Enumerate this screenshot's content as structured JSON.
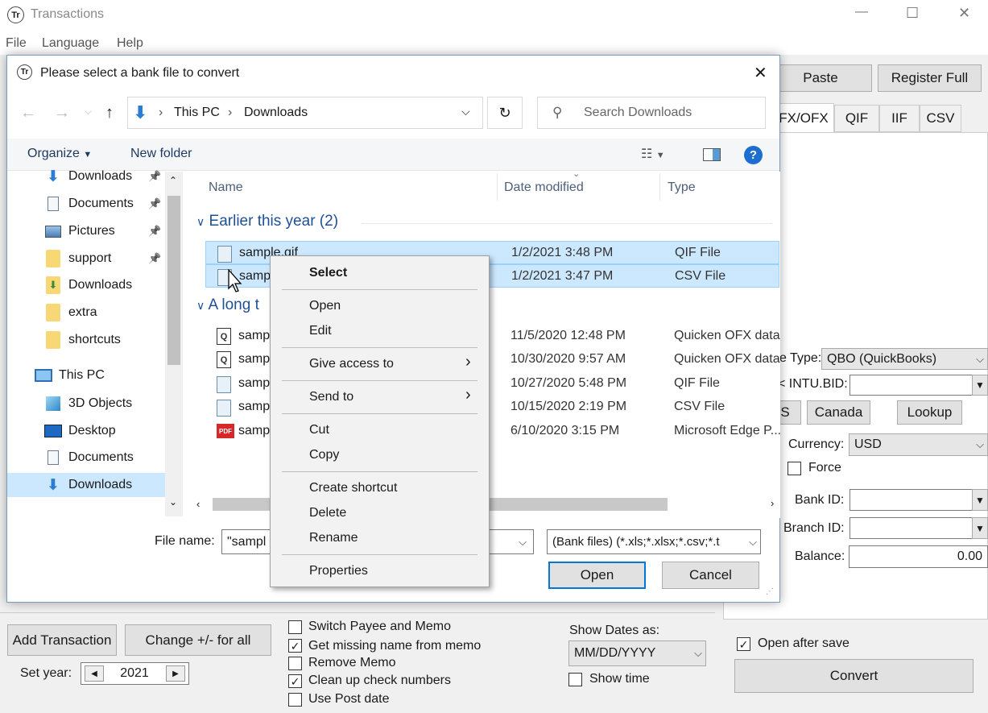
{
  "app": {
    "title": "Transactions",
    "icon_text": "Tr",
    "menu": [
      "File",
      "Language",
      "Help"
    ],
    "window_controls": {
      "minimize": "—",
      "maximize": "☐",
      "close": "✕"
    }
  },
  "right_panel": {
    "paste_label": "Paste",
    "register_label": "Register Full",
    "tabs": [
      "FX/OFX",
      "QIF",
      "IIF",
      "CSV"
    ],
    "type_label": "e Type:",
    "type_value": "QBO (QuickBooks)",
    "intubid_label": "< INTU.BID:",
    "intubid_value": "",
    "s_label": "S",
    "canada_label": "Canada",
    "lookup_label": "Lookup",
    "currency_label": "Currency:",
    "currency_value": "USD",
    "force_label": "Force",
    "bankid_label": "Bank ID:",
    "branchid_label": "Branch ID:",
    "balance_label": "Balance:",
    "balance_value": "0.00",
    "open_after_save_label": "Open after save",
    "convert_label": "Convert"
  },
  "bottom": {
    "add_transaction": "Add Transaction",
    "change_sign": "Change +/- for all",
    "set_year_label": "Set year:",
    "year_value": "2021",
    "options": [
      {
        "label": "Switch Payee and Memo",
        "checked": false
      },
      {
        "label": "Get missing name from memo",
        "checked": true
      },
      {
        "label": "Remove Memo",
        "checked": false
      },
      {
        "label": "Clean up check numbers",
        "checked": true
      },
      {
        "label": "Use Post date",
        "checked": false
      }
    ],
    "show_dates_label": "Show Dates as:",
    "date_format": "MM/DD/YYYY",
    "show_time_label": "Show time"
  },
  "dialog": {
    "title": "Please select a bank file to convert",
    "breadcrumb": [
      "This PC",
      "Downloads"
    ],
    "search_placeholder": "Search Downloads",
    "organize_label": "Organize",
    "new_folder_label": "New folder",
    "nav_items": [
      {
        "label": "Downloads",
        "icon": "download-arrow-icon",
        "pinned": true
      },
      {
        "label": "Documents",
        "icon": "document-icon",
        "pinned": true
      },
      {
        "label": "Pictures",
        "icon": "pictures-icon",
        "pinned": true
      },
      {
        "label": "support",
        "icon": "folder-icon",
        "pinned": true
      },
      {
        "label": "Downloads",
        "icon": "folder-download-icon",
        "pinned": false
      },
      {
        "label": "extra",
        "icon": "folder-icon",
        "pinned": false
      },
      {
        "label": "shortcuts",
        "icon": "folder-icon",
        "pinned": false
      },
      {
        "label": "This PC",
        "icon": "computer-icon",
        "pinned": false
      },
      {
        "label": "3D Objects",
        "icon": "cube-icon",
        "pinned": false
      },
      {
        "label": "Desktop",
        "icon": "desktop-icon",
        "pinned": false
      },
      {
        "label": "Documents",
        "icon": "document-icon",
        "pinned": false
      },
      {
        "label": "Downloads",
        "icon": "download-arrow-icon",
        "pinned": false
      }
    ],
    "columns": [
      "Name",
      "Date modified",
      "Type"
    ],
    "group1": "Earlier this year (2)",
    "group2": "A long t",
    "files_group1": [
      {
        "name": "sample.qif",
        "date": "1/2/2021 3:48 PM",
        "type": "QIF File"
      },
      {
        "name": "sampl",
        "date": "1/2/2021 3:47 PM",
        "type": "CSV File"
      }
    ],
    "files_group2": [
      {
        "name": "sampl",
        "date": "11/5/2020 12:48 PM",
        "type": "Quicken OFX data"
      },
      {
        "name": "sampl",
        "date": "10/30/2020 9:57 AM",
        "type": "Quicken OFX data"
      },
      {
        "name": "sampl",
        "date": "10/27/2020 5:48 PM",
        "type": "QIF File"
      },
      {
        "name": "sampl",
        "date": "10/15/2020 2:19 PM",
        "type": "CSV File"
      },
      {
        "name": "sampl",
        "date": "6/10/2020 3:15 PM",
        "type": "Microsoft Edge P..."
      }
    ],
    "filename_label": "File name:",
    "filename_value": "\"sampl",
    "filter_value": "(Bank files) (*.xls;*.xlsx;*.csv;*.t",
    "open_label": "Open",
    "cancel_label": "Cancel"
  },
  "context_menu": {
    "select": "Select",
    "open": "Open",
    "edit": "Edit",
    "give_access": "Give access to",
    "send_to": "Send to",
    "cut": "Cut",
    "copy": "Copy",
    "create_shortcut": "Create shortcut",
    "delete": "Delete",
    "rename": "Rename",
    "properties": "Properties"
  }
}
